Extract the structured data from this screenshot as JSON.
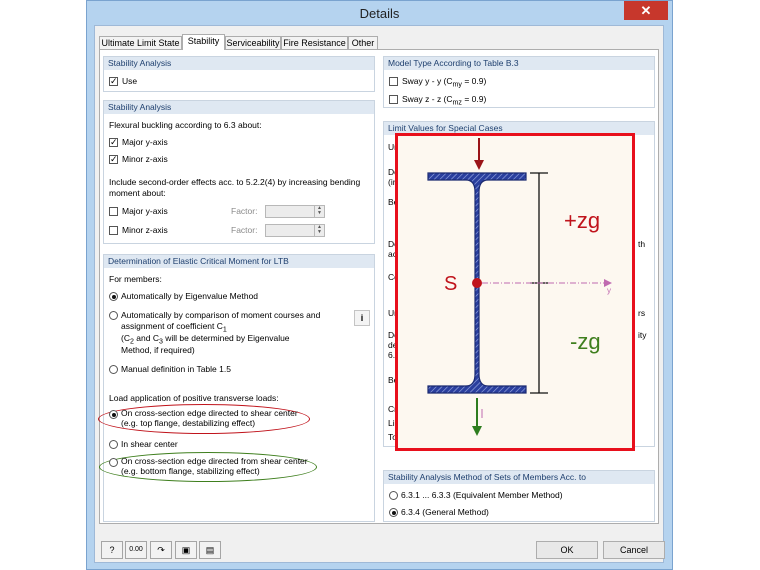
{
  "window": {
    "title": "Details",
    "close_glyph": "✕"
  },
  "tabs": [
    {
      "label": "Ultimate Limit State"
    },
    {
      "label": "Stability"
    },
    {
      "label": "Serviceability"
    },
    {
      "label": "Fire Resistance"
    },
    {
      "label": "Other"
    }
  ],
  "stability_analysis_1": {
    "title": "Stability Analysis",
    "use_label": "Use",
    "use_checked": true
  },
  "stability_analysis_2": {
    "title": "Stability Analysis",
    "flexural_text": "Flexural buckling according to 6.3 about:",
    "major_label": "Major y-axis",
    "minor_label": "Minor z-axis",
    "second_order_line1": "Include second-order effects acc. to 5.2.2(4) by increasing bending",
    "second_order_line2": "moment about:",
    "major2_label": "Major y-axis",
    "minor2_label": "Minor z-axis",
    "factor_label": "Factor:"
  },
  "ltb": {
    "title": "Determination of Elastic Critical Moment for LTB",
    "for_members": "For members:",
    "opt_eigen": "Automatically by Eigenvalue Method",
    "opt_comp_l1": "Automatically by comparison of moment courses and",
    "opt_comp_l2": "assignment of coefficient C",
    "opt_comp_sub": "1",
    "opt_comp_l3a": "(C",
    "opt_comp_l3s1": "2",
    "opt_comp_l3b": " and C",
    "opt_comp_l3s2": "3",
    "opt_comp_l3c": " will be determined by Eigenvalue",
    "opt_comp_l4": "Method, if required)",
    "opt_manual": "Manual definition in Table 1.5",
    "load_app": "Load application of positive transverse loads:",
    "edge_to_l1": "On cross-section edge directed to shear center",
    "edge_to_l2": "(e.g. top flange, destabilizing effect)",
    "in_shear": "In shear center",
    "edge_from_l1": "On cross-section edge directed from shear center",
    "edge_from_l2": "(e.g. bottom flange, stabilizing effect)",
    "info_glyph": "i"
  },
  "model_type": {
    "title": "Model Type According to Table B.3",
    "sway_y_a": "Sway y - y (C",
    "sway_y_sub": "my",
    "sway_y_b": " = 0.9)",
    "sway_z_a": "Sway z - z (C",
    "sway_z_sub": "mz",
    "sway_z_b": " = 0.9)"
  },
  "limit_values": {
    "title": "Limit Values for Special Cases",
    "fragments": [
      "Un",
      "Do",
      "(int",
      "Be",
      "Do",
      "acc",
      "Co",
      "Un",
      "Do",
      "des",
      "6.3",
      "Be",
      "Cro",
      "Lim",
      "Tor"
    ],
    "right_fragments": [
      "th",
      "rs",
      "ity"
    ]
  },
  "method": {
    "title": "Stability Analysis Method of Sets of Members Acc. to",
    "opt1": "6.3.1 ... 6.3.3 (Equivalent Member Method)",
    "opt2": "6.3.4  (General Method)"
  },
  "diagram": {
    "plus_zg": "+zg",
    "minus_zg": "-zg",
    "s_label": "S",
    "y_label": "y",
    "colors": {
      "frame": "#e8101c",
      "flange": "#2a3f9e",
      "label_red": "#c0141c",
      "label_green": "#3f7f1e",
      "arrow_red": "#9a1418",
      "arrow_green": "#2e7d1f"
    }
  },
  "bottom": {
    "ok_label": "OK",
    "cancel_label": "Cancel",
    "units_label": "0.00"
  }
}
